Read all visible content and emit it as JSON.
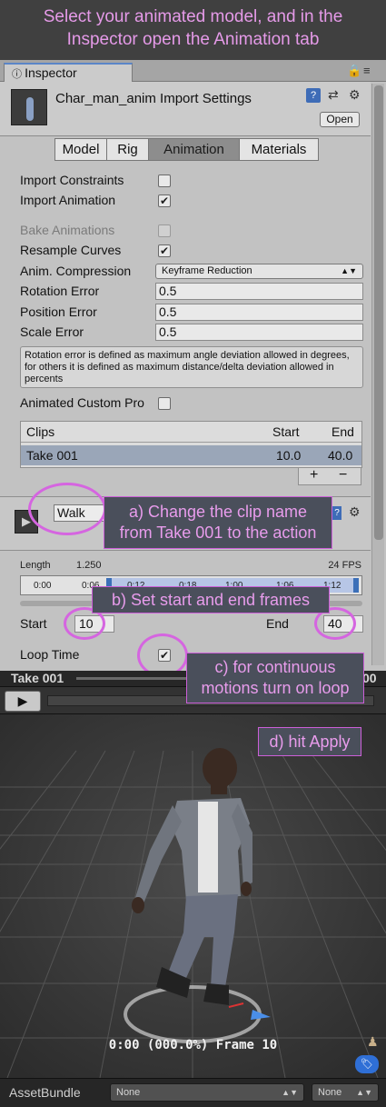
{
  "banner": {
    "line1": "Select your animated model, and in the",
    "line2": "Inspector open the Animation tab"
  },
  "inspector": {
    "tab_label": "Inspector",
    "lock_icon": "lock-icon",
    "menu_icon": "menu-icon",
    "header_title": "Char_man_anim Import Settings",
    "open_label": "Open",
    "help_icon": "?",
    "tabs": [
      "Model",
      "Rig",
      "Animation",
      "Materials"
    ],
    "active_tab": "Animation"
  },
  "settings": {
    "import_constraints": {
      "label": "Import Constraints",
      "checked": false
    },
    "import_animation": {
      "label": "Import Animation",
      "checked": true
    },
    "bake_animations": {
      "label": "Bake Animations",
      "checked": false
    },
    "resample_curves": {
      "label": "Resample Curves",
      "checked": true
    },
    "anim_compression": {
      "label": "Anim. Compression",
      "value": "Keyframe Reduction"
    },
    "rotation_error": {
      "label": "Rotation Error",
      "value": "0.5"
    },
    "position_error": {
      "label": "Position Error",
      "value": "0.5"
    },
    "scale_error": {
      "label": "Scale Error",
      "value": "0.5"
    },
    "help_text": "Rotation error is defined as maximum angle deviation allowed in degrees, for others it is defined as maximum distance/delta deviation allowed in percents",
    "animated_custom_props": {
      "label": "Animated Custom Pro",
      "checked": false
    }
  },
  "clips": {
    "headers": {
      "name": "Clips",
      "start": "Start",
      "end": "End"
    },
    "rows": [
      {
        "name": "Take 001",
        "start": "10.0",
        "end": "40.0"
      }
    ],
    "add": "+",
    "remove": "−"
  },
  "clip_editor": {
    "name": "Walk",
    "length_label": "Length",
    "length_value": "1.250",
    "fps": "24 FPS",
    "ticks": [
      "0:00",
      "0:06",
      "0:12",
      "0:18",
      "1:00",
      "1:06",
      "1:12"
    ],
    "start_label": "Start",
    "start_value": "10",
    "end_label": "End",
    "end_value": "40",
    "loop_label": "Loop Time",
    "loop_checked": true
  },
  "callouts": {
    "a": [
      "a) Change the clip name",
      "from Take 001 to the action"
    ],
    "b": "b) Set start and end frames",
    "c": [
      "c) for continuous",
      "motions turn on loop"
    ],
    "d": "d) hit Apply"
  },
  "preview": {
    "title": "Take 001",
    "right_text": "00",
    "play_icon": "▶",
    "frame_text": "0:00 (000.0%) Frame 10"
  },
  "assetbundle": {
    "label": "AssetBundle",
    "name_value": "None",
    "variant_value": "None"
  },
  "colors": {
    "annotation": "#e89cec",
    "ring": "#d565e0",
    "accent_blue": "#3c6fb8"
  }
}
